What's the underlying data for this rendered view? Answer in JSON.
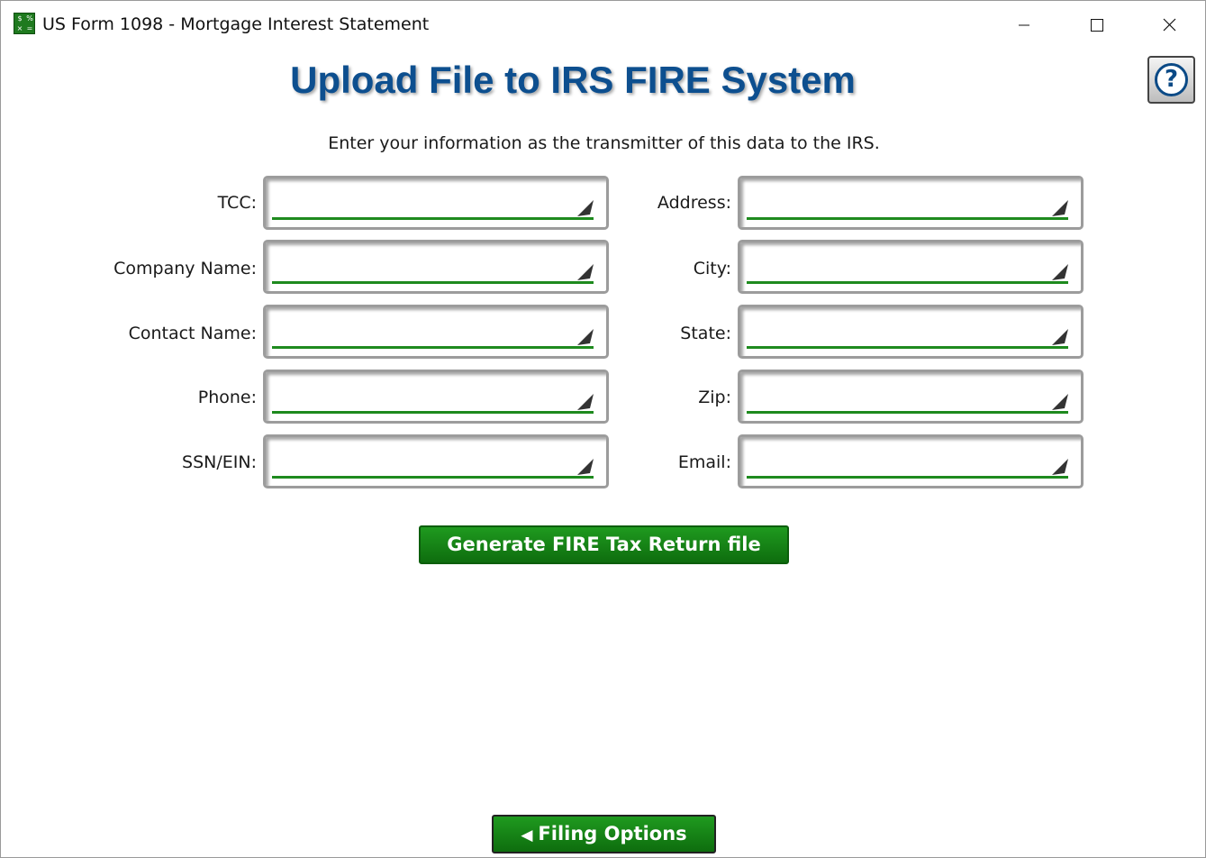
{
  "window": {
    "title": "US Form 1098 - Mortgage Interest Statement",
    "icon": "calculator-app-icon",
    "controls": [
      "minimize-icon",
      "maximize-icon",
      "close-icon"
    ]
  },
  "help": {
    "label": "?",
    "icon": "help-icon"
  },
  "page": {
    "title": "Upload File to IRS FIRE System",
    "subtitle": "Enter your information as the transmitter of this data to the IRS."
  },
  "fields_left": [
    {
      "label": "TCC:",
      "value": ""
    },
    {
      "label": "Company Name:",
      "value": ""
    },
    {
      "label": "Contact Name:",
      "value": ""
    },
    {
      "label": "Phone:",
      "value": ""
    },
    {
      "label": "SSN/EIN:",
      "value": ""
    }
  ],
  "fields_right": [
    {
      "label": "Address:",
      "value": ""
    },
    {
      "label": "City:",
      "value": ""
    },
    {
      "label": "State:",
      "value": ""
    },
    {
      "label": "Zip:",
      "value": ""
    },
    {
      "label": "Email:",
      "value": ""
    }
  ],
  "buttons": {
    "generate": "Generate FIRE Tax Return file",
    "filing_options": "Filing Options",
    "filing_arrow": "◀"
  },
  "colors": {
    "title_blue": "#0d4f8f",
    "button_green": "#1e8a1e",
    "field_underline": "#1e8a1e"
  }
}
